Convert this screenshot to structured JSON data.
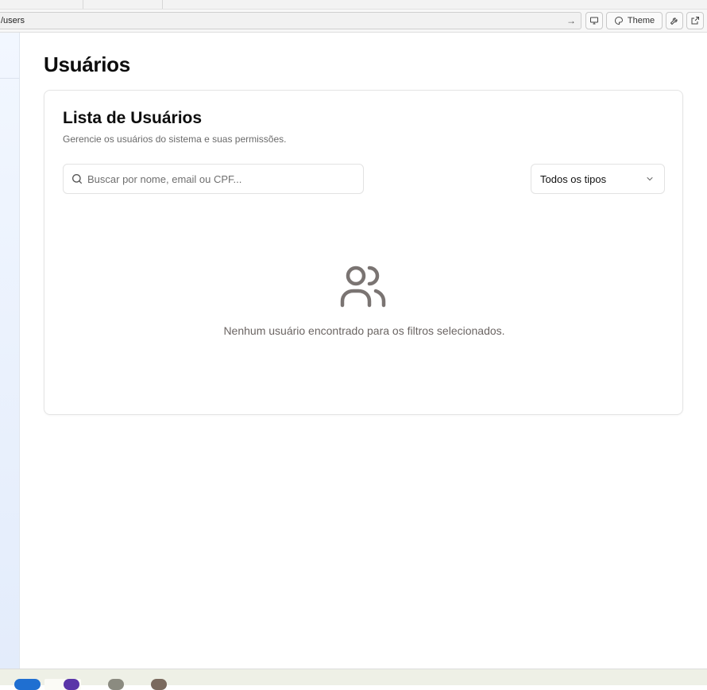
{
  "browser": {
    "url_text": "/users",
    "theme_label": "Theme"
  },
  "page": {
    "title": "Usuários"
  },
  "card": {
    "title": "Lista de Usuários",
    "subtitle": "Gerencie os usuários do sistema e suas permissões.",
    "search_placeholder": "Buscar por nome, email ou CPF...",
    "filter_selected": "Todos os tipos",
    "empty_message": "Nenhum usuário encontrado para os filtros selecionados."
  },
  "colors": {
    "empty_icon": "#7a7472",
    "muted_text": "#6b6b6b",
    "sidebar_bg": "#e9f0fc"
  },
  "icons": {
    "search": "search-icon",
    "chevron": "chevron-down-icon",
    "empty": "users-icon",
    "monitor": "monitor-icon",
    "palette": "palette-icon",
    "wrench": "wrench-icon",
    "external": "external-link-icon",
    "arrow": "arrow-right-icon"
  }
}
